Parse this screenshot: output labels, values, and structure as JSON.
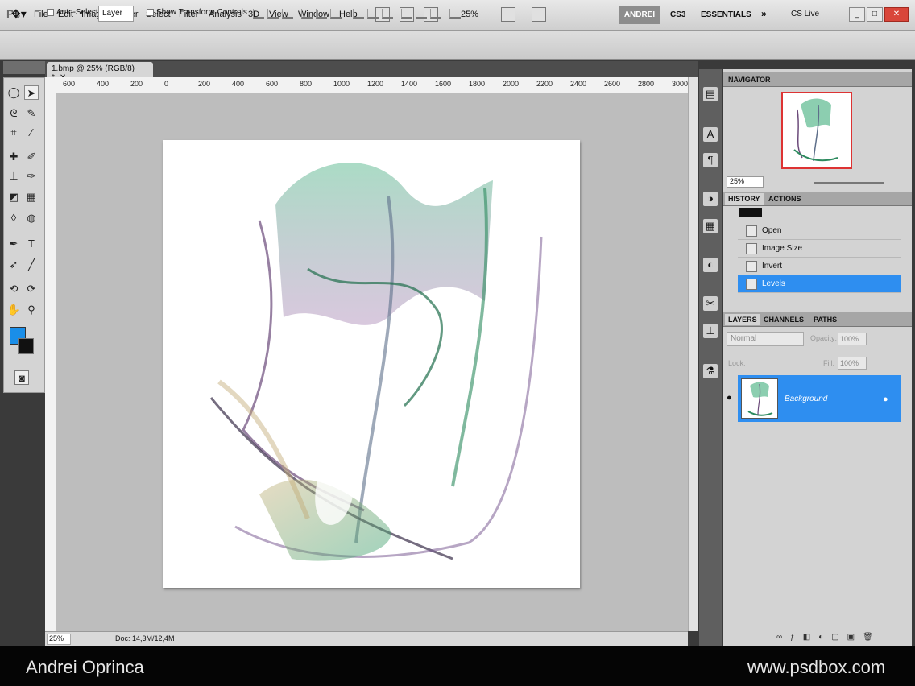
{
  "app": {
    "logo": "Ps"
  },
  "menu": [
    "File",
    "Edit",
    "Image",
    "Layer",
    "Select",
    "Filter",
    "Analysis",
    "3D",
    "View",
    "Window",
    "Help"
  ],
  "toolbar": {
    "zoom": "25%"
  },
  "workspace": {
    "active": "ANDREI",
    "items": [
      "CS3",
      "ESSENTIALS"
    ],
    "more": "»",
    "cslive": "CS Live"
  },
  "options": {
    "auto_select": "Auto-Select:",
    "layer_select": "Layer",
    "transform": "Show Transform Controls"
  },
  "document": {
    "tab_title": "1.bmp @ 25% (RGB/8) *",
    "ruler_ticks": [
      "600",
      "400",
      "200",
      "0",
      "200",
      "400",
      "600",
      "800",
      "1000",
      "1200",
      "1400",
      "1600",
      "1800",
      "2000",
      "2200",
      "2400",
      "2600",
      "2800",
      "3000"
    ],
    "status_zoom": "25%",
    "status_doc": "Doc: 14,3M/12,4M",
    "fg_color": "#1a8ee8",
    "bg_color": "#111111"
  },
  "navigator": {
    "tab": "NAVIGATOR",
    "zoom": "25%"
  },
  "history": {
    "tabs": [
      "HISTORY",
      "ACTIONS"
    ],
    "items": [
      "Open",
      "Image Size",
      "Invert",
      "Levels"
    ]
  },
  "layers": {
    "tabs": [
      "LAYERS",
      "CHANNELS",
      "PATHS"
    ],
    "blend": "Normal",
    "opacity_label": "Opacity:",
    "opacity": "100%",
    "lock_label": "Lock:",
    "fill_label": "Fill:",
    "fill": "100%",
    "layer_name": "Background"
  },
  "footer": {
    "author": "Andrei Oprinca",
    "site": "www.psdbox.com"
  }
}
